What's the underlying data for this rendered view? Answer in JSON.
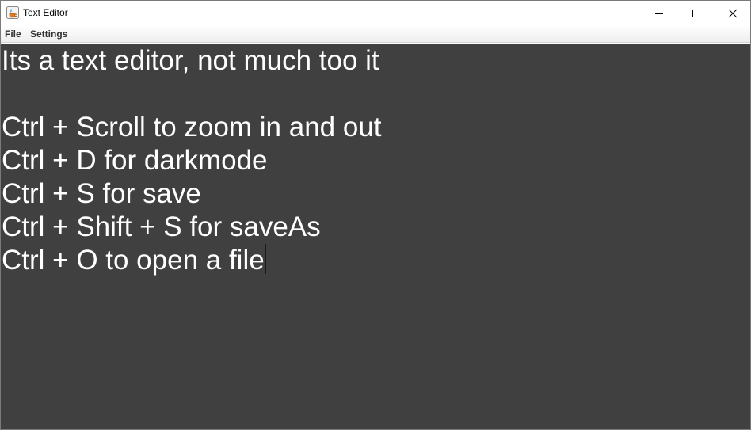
{
  "window": {
    "title": "Text Editor",
    "app_icon": "java-coffee-cup-icon",
    "controls": [
      "minimize-icon",
      "maximize-icon",
      "close-icon"
    ]
  },
  "menubar": {
    "items": [
      {
        "label": "File"
      },
      {
        "label": "Settings"
      }
    ]
  },
  "editor": {
    "background": "#404040",
    "text_color": "#ffffff",
    "lines": [
      "Its a text editor, not much too it",
      "",
      "Ctrl + Scroll to zoom in and out",
      "Ctrl + D for darkmode",
      "Ctrl + S for save",
      "Ctrl + Shift + S for saveAs",
      "Ctrl + O to open a file"
    ]
  }
}
